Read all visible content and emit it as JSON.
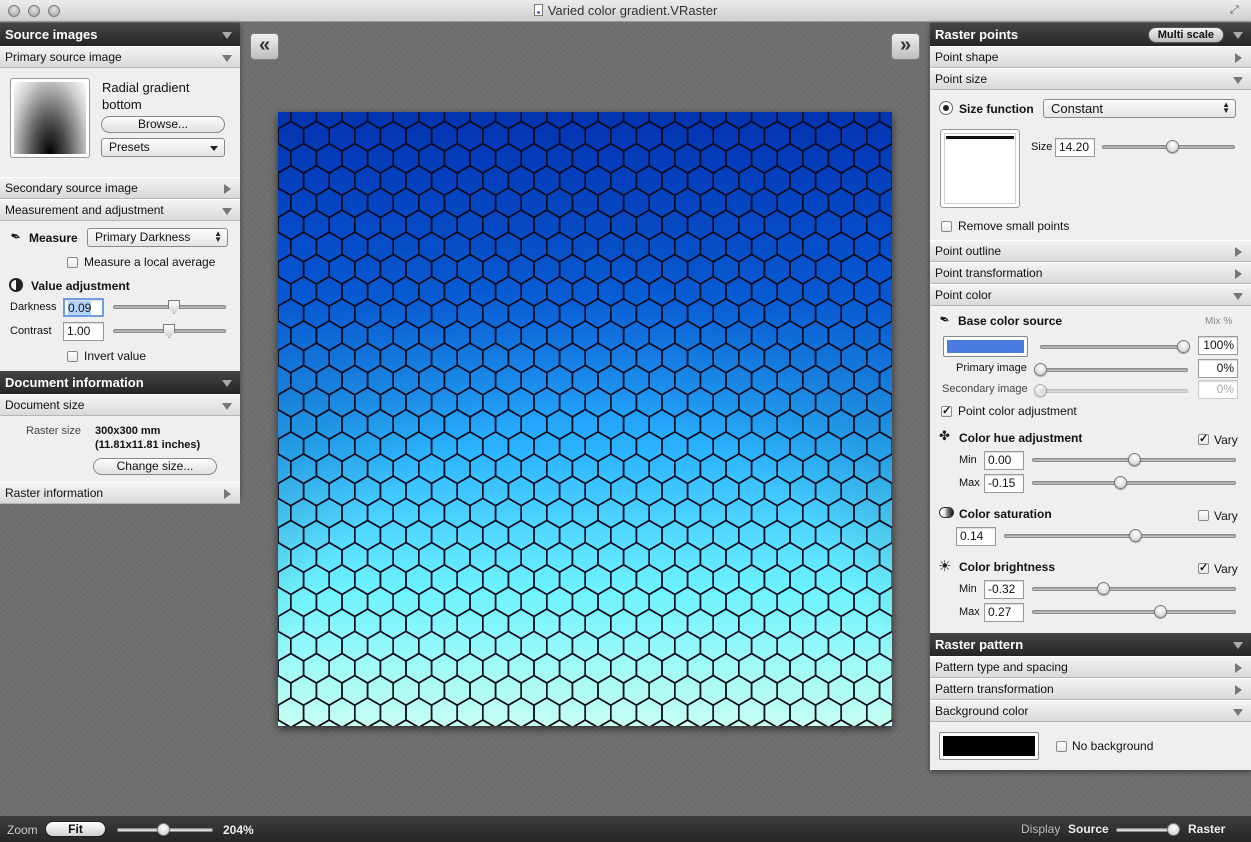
{
  "window": {
    "title": "Varied color gradient.VRaster"
  },
  "left": {
    "source_images_title": "Source images",
    "primary_source_label": "Primary source image",
    "primary_name": "Radial gradient bottom",
    "browse_label": "Browse...",
    "presets_label": "Presets",
    "secondary_source_label": "Secondary source image",
    "measurement_label": "Measurement and adjustment",
    "measure_label": "Measure",
    "measure_value": "Primary Darkness",
    "local_average_label": "Measure a local average",
    "value_adjustment_label": "Value adjustment",
    "darkness_label": "Darkness",
    "darkness_value": "0.09",
    "contrast_label": "Contrast",
    "contrast_value": "1.00",
    "invert_label": "Invert value",
    "doc_info_title": "Document information",
    "doc_size_label": "Document size",
    "raster_size_label": "Raster size",
    "raster_size_mm": "300x300 mm",
    "raster_size_in": "(11.81x11.81 inches)",
    "change_size_label": "Change size...",
    "raster_info_label": "Raster information"
  },
  "right": {
    "raster_points_title": "Raster points",
    "multi_scale_label": "Multi scale",
    "point_shape_label": "Point shape",
    "point_size_label": "Point size",
    "size_function_label": "Size function",
    "size_function_value": "Constant",
    "size_label": "Size",
    "size_value": "14.20",
    "remove_small_label": "Remove small points",
    "point_outline_label": "Point outline",
    "point_transformation_label": "Point transformation",
    "point_color_label": "Point color",
    "base_color_source_label": "Base color source",
    "mix_label": "Mix %",
    "base_mix_value": "100%",
    "primary_image_label": "Primary image",
    "primary_mix_value": "0%",
    "secondary_image_label": "Secondary image",
    "secondary_mix_value": "0%",
    "point_color_adjustment_label": "Point color adjustment",
    "hue_adjustment_label": "Color hue adjustment",
    "vary_label": "Vary",
    "min_label": "Min",
    "max_label": "Max",
    "hue_min": "0.00",
    "hue_max": "-0.15",
    "saturation_label": "Color saturation",
    "saturation_value": "0.14",
    "brightness_label": "Color brightness",
    "brightness_min": "-0.32",
    "brightness_max": "0.27",
    "raster_pattern_title": "Raster pattern",
    "pattern_type_label": "Pattern type and spacing",
    "pattern_transformation_label": "Pattern transformation",
    "background_color_label": "Background color",
    "no_background_label": "No background"
  },
  "colors": {
    "base_color": "#4a7be0",
    "background_color": "#000000"
  },
  "bottom": {
    "zoom_label": "Zoom",
    "fit_label": "Fit",
    "zoom_value": "204%",
    "display_label": "Display",
    "source_label": "Source",
    "raster_label": "Raster"
  },
  "icons": {
    "prev": "«",
    "next": "»"
  }
}
